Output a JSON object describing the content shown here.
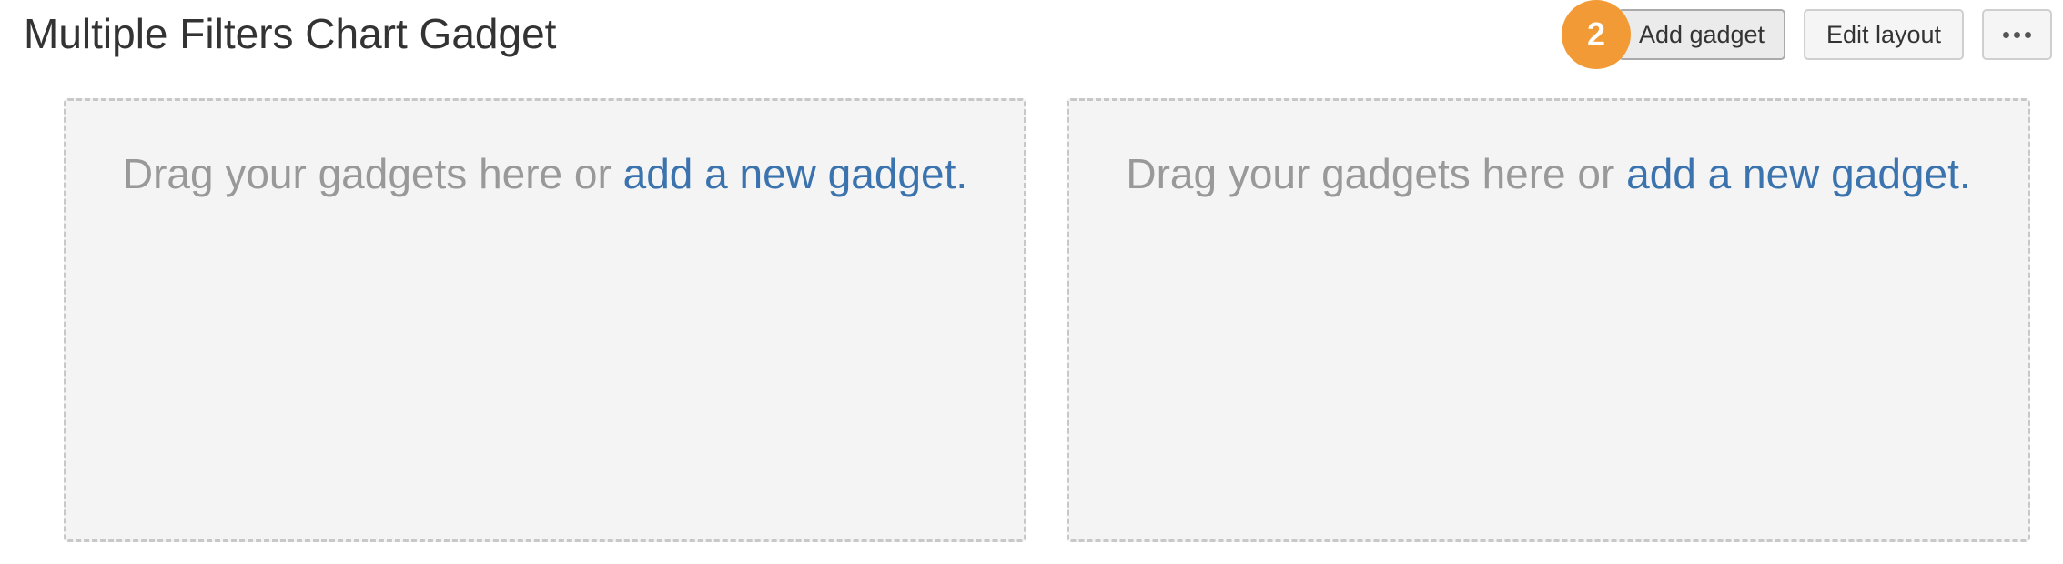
{
  "header": {
    "title": "Multiple Filters Chart Gadget"
  },
  "toolbar": {
    "step_badge": "2",
    "add_gadget_label": "Add gadget",
    "edit_layout_label": "Edit layout",
    "more_icon": "more-horizontal-icon"
  },
  "columns": [
    {
      "message": "Drag your gadgets here or ",
      "link_text": "add a new gadget."
    },
    {
      "message": "Drag your gadgets here or ",
      "link_text": "add a new gadget."
    }
  ],
  "colors": {
    "badge": "#f29b36",
    "link": "#3b73af",
    "placeholder_text": "#999999",
    "drop_zone_bg": "#f4f4f4"
  }
}
